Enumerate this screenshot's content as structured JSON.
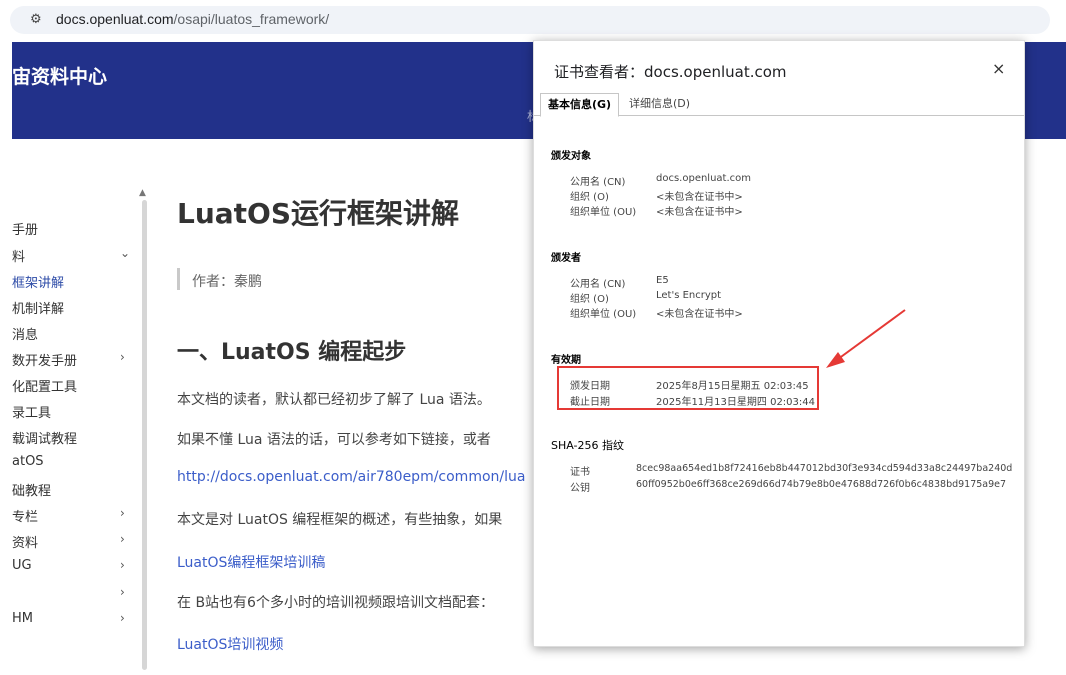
{
  "browser": {
    "url_host": "docs.openluat.com",
    "url_path": "/osapi/luatos_framework/"
  },
  "site": {
    "title": "宙资料中心"
  },
  "sidebar": {
    "items": [
      {
        "label": "手册",
        "arrow": ""
      },
      {
        "label": "料",
        "arrow": "⌄"
      },
      {
        "label": "框架讲解",
        "arrow": "",
        "active": true
      },
      {
        "label": "机制详解",
        "arrow": ""
      },
      {
        "label": "消息",
        "arrow": ""
      },
      {
        "label": "数开发手册",
        "arrow": "›"
      },
      {
        "label": "化配置工具",
        "arrow": ""
      },
      {
        "label": "录工具",
        "arrow": ""
      },
      {
        "label": "载调试教程",
        "arrow": ""
      },
      {
        "label": "atOS",
        "arrow": ""
      },
      {
        "label": "础教程",
        "arrow": ""
      },
      {
        "label": "专栏",
        "arrow": "›"
      },
      {
        "label": "资料",
        "arrow": "›"
      },
      {
        "label": "UG",
        "arrow": "›"
      },
      {
        "label": "",
        "arrow": "›"
      },
      {
        "label": "HM",
        "arrow": "›"
      }
    ]
  },
  "article": {
    "title": "LuatOS运行框架讲解",
    "author": "作者：秦鹏",
    "h2": "一、LuatOS 编程起步",
    "p1": "本文档的读者，默认都已经初步了解了 Lua 语法。",
    "p2": "如果不懂 Lua 语法的话，可以参考如下链接，或者",
    "p3_link": "http://docs.openluat.com/air780epm/common/lua",
    "p4": "本文是对 LuatOS 编程框架的概述，有些抽象，如果",
    "p5_link": "LuatOS编程框架培训稿",
    "p6": "在 B站也有6个多小时的培训视频跟培训文档配套：",
    "p7_link": "LuatOS培训视频"
  },
  "cert_dialog": {
    "title": "证书查看者：docs.openluat.com",
    "close": "×",
    "tab_basic": "基本信息(G)",
    "tab_detail": "详细信息(D)",
    "issued_to": {
      "heading": "颁发对象",
      "rows": [
        {
          "label": "公用名 (CN)",
          "value": "docs.openluat.com"
        },
        {
          "label": "组织 (O)",
          "value": "<未包含在证书中>"
        },
        {
          "label": "组织单位 (OU)",
          "value": "<未包含在证书中>"
        }
      ]
    },
    "issued_by": {
      "heading": "颁发者",
      "rows": [
        {
          "label": "公用名 (CN)",
          "value": "E5"
        },
        {
          "label": "组织 (O)",
          "value": "Let's Encrypt"
        },
        {
          "label": "组织单位 (OU)",
          "value": "<未包含在证书中>"
        }
      ]
    },
    "validity": {
      "heading": "有效期",
      "issued_label": "颁发日期",
      "issued_value": "2025年8月15日星期五 02:03:45",
      "expires_label": "截止日期",
      "expires_value": "2025年11月13日星期四 02:03:44"
    },
    "sha256": {
      "heading": "SHA-256 指纹",
      "cert_label": "证书",
      "cert_value": "8cec98aa654ed1b8f72416eb8b447012bd30f3e934cd594d33a8c24497ba240d",
      "key_label": "公钥",
      "key_value": "60ff0952b0e6ff368ce269d66d74b79e8b0e47688d726f0b6c4838bd9175a9e7"
    }
  },
  "annotation": {
    "color": "#e53935"
  }
}
